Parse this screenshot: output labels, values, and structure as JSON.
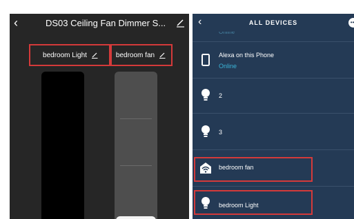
{
  "left_screen": {
    "title": "DS03 Ceiling Fan Dimmer S...",
    "devices": [
      {
        "label": "bedroom Light",
        "level": 0.0
      },
      {
        "label": "bedroom fan",
        "level": 0.05
      }
    ]
  },
  "right_screen": {
    "title": "ALL DEVICES",
    "cutoff_status": "Online",
    "items": [
      {
        "name": "Alexa on this Phone",
        "status": "Online",
        "icon": "phone-icon"
      },
      {
        "name": "2",
        "icon": "bulb-icon"
      },
      {
        "name": "3",
        "icon": "bulb-icon"
      },
      {
        "name": "bedroom fan",
        "icon": "wifi-plug-icon"
      },
      {
        "name": "bedroom Light",
        "icon": "bulb-icon"
      }
    ]
  },
  "colors": {
    "highlight": "#d53a3a",
    "right_background": "#243a55",
    "left_background": "#262626",
    "online": "#3bb4d8"
  }
}
